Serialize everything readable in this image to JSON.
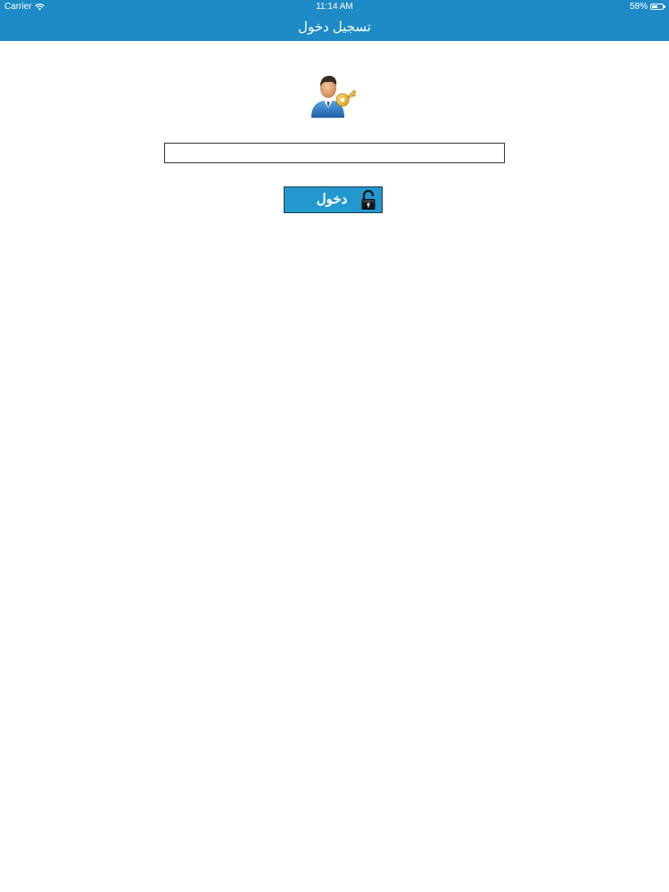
{
  "status_bar": {
    "carrier": "Carrier",
    "time": "11:14 AM",
    "battery_percent_label": "58%",
    "battery_level": 0.58
  },
  "nav": {
    "title": "تسجيل دخول"
  },
  "login": {
    "username_value": "",
    "button_label": "دخول"
  },
  "icons": {
    "avatar": "user-key-icon",
    "button": "unlocked-padlock-icon",
    "wifi": "wifi-icon",
    "battery": "battery-icon"
  },
  "colors": {
    "nav_background": "#1f8bc6",
    "button_background": "#2398cf",
    "button_border": "#1b3b52",
    "field_border": "#333333"
  }
}
